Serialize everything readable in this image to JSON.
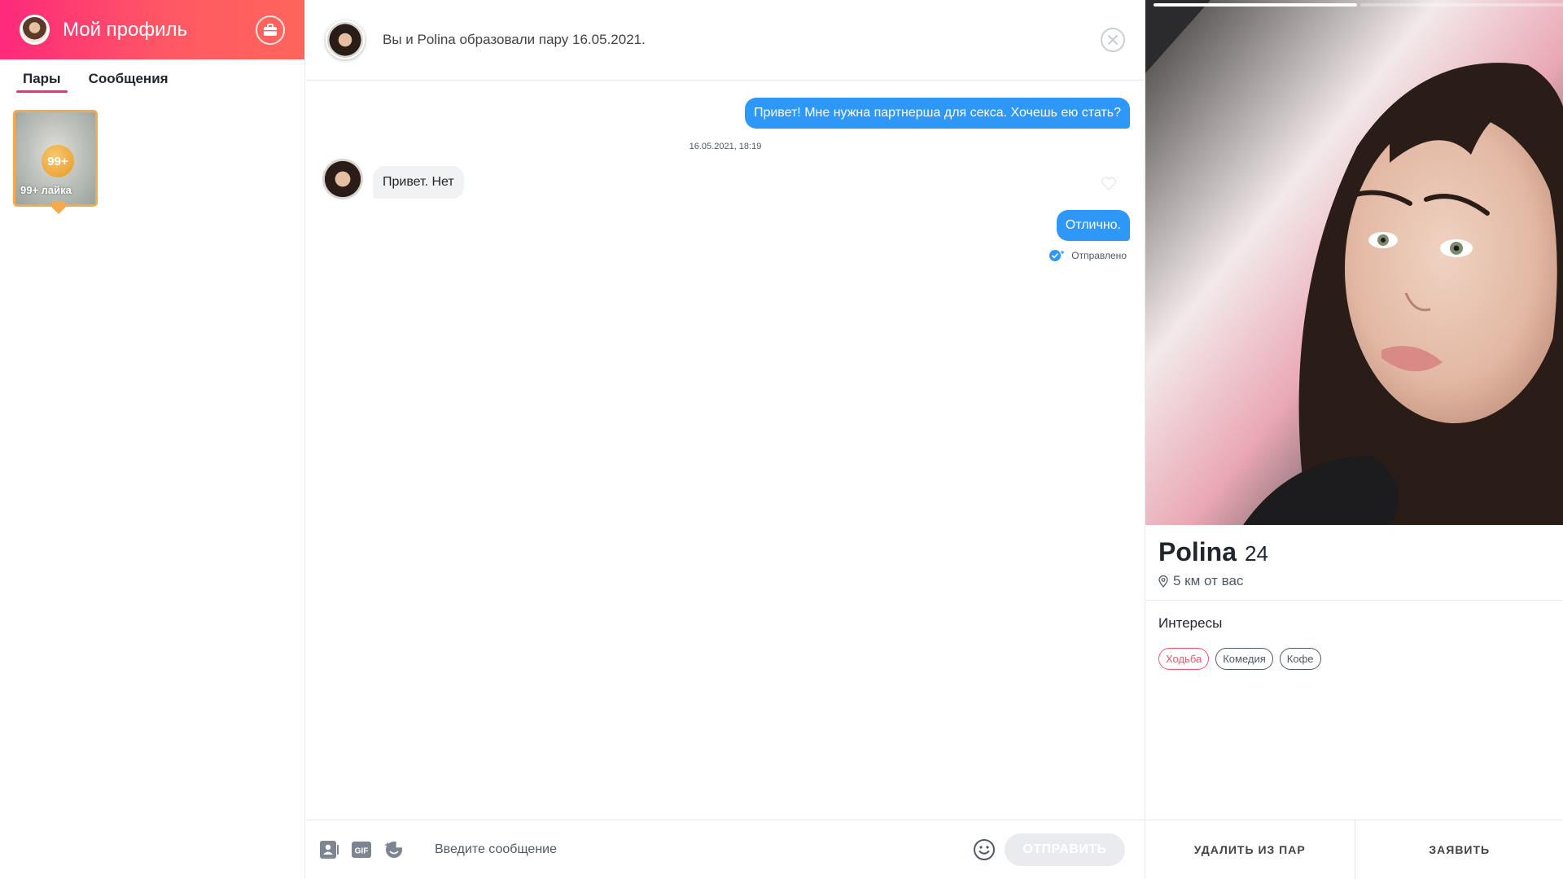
{
  "sidebar": {
    "profile_title": "Мой профиль",
    "tabs": [
      {
        "label": "Пары",
        "active": true
      },
      {
        "label": "Сообщения",
        "active": false
      }
    ],
    "likes_card": {
      "badge": "99+",
      "label": "99+ лайка"
    }
  },
  "chat": {
    "header_text": "Вы и Polina образовали пару 16.05.2021.",
    "messages": [
      {
        "direction": "out",
        "text": "Привет! Мне нужна партнерша для секса. Хочешь ею стать?"
      },
      {
        "direction": "timestamp",
        "text": "16.05.2021, 18:19"
      },
      {
        "direction": "in",
        "text": "Привет. Нет"
      },
      {
        "direction": "out",
        "text": "Отлично."
      }
    ],
    "sent_status": "Отправлено",
    "composer": {
      "placeholder": "Введите сообщение",
      "send_label": "ОТПРАВИТЬ",
      "gif_label": "GIF"
    }
  },
  "profile": {
    "name": "Polina",
    "age": "24",
    "distance": "5 км от вас",
    "interests_title": "Интересы",
    "interests": [
      {
        "label": "Ходьба",
        "shared": true
      },
      {
        "label": "Комедия",
        "shared": false
      },
      {
        "label": "Кофе",
        "shared": false
      }
    ],
    "photo_count": 2,
    "active_photo": 1,
    "actions": {
      "unmatch": "УДАЛИТЬ ИЗ ПАР",
      "report": "ЗАЯВИТЬ"
    }
  },
  "colors": {
    "brand_gradient_start": "#fd297b",
    "brand_gradient_end": "#ff655b",
    "outgoing_bubble": "#2e98f8",
    "incoming_bubble": "#f0f2f4",
    "likes_gold": "#f6a84b"
  },
  "icons": [
    "briefcase-icon",
    "close-icon",
    "heart-icon",
    "check-icon",
    "contact-card-icon",
    "gif-icon",
    "sticker-icon",
    "emoji-icon",
    "location-pin-icon"
  ]
}
